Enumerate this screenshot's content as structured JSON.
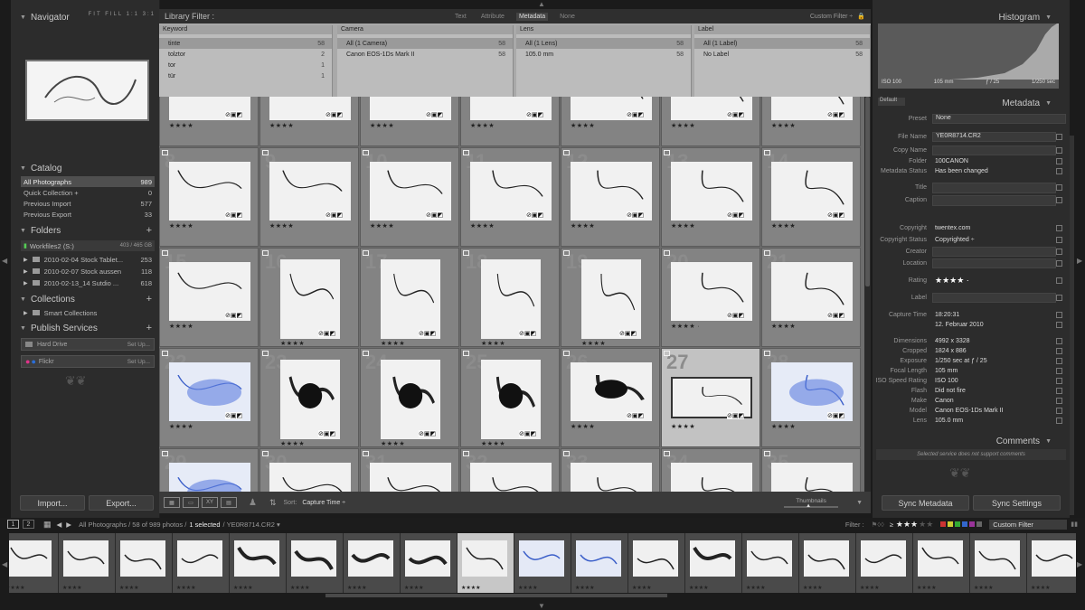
{
  "left_panel": {
    "navigator": {
      "title": "Navigator",
      "zoom_options": "FIT  FILL  1:1  3:1"
    },
    "catalog": {
      "title": "Catalog",
      "items": [
        {
          "label": "All Photographs",
          "count": "989"
        },
        {
          "label": "Quick Collection +",
          "count": "0"
        },
        {
          "label": "Previous Import",
          "count": "577"
        },
        {
          "label": "Previous Export",
          "count": "33"
        }
      ]
    },
    "folders": {
      "title": "Folders",
      "volume": "Workfiles2 (S:)",
      "volume_size": "403 / 465 GB",
      "items": [
        {
          "label": "2010-02-04 Stock Tablet...",
          "count": "253"
        },
        {
          "label": "2010-02-07 Stock aussen",
          "count": "118"
        },
        {
          "label": "2010-02-13_14 Sutdio ...",
          "count": "618"
        }
      ]
    },
    "collections": {
      "title": "Collections",
      "items": [
        "Smart Collections"
      ]
    },
    "publish": {
      "title": "Publish Services",
      "items": [
        {
          "label": "Hard Drive",
          "action": "Set Up..."
        },
        {
          "label": "Flickr",
          "action": "Set Up..."
        }
      ]
    },
    "import_label": "Import...",
    "export_label": "Export..."
  },
  "filter": {
    "title": "Library Filter :",
    "tabs": [
      "Text",
      "Attribute",
      "Metadata",
      "None"
    ],
    "active_tab": "Metadata",
    "preset": "Custom Filter ÷",
    "columns": [
      {
        "header": "Keyword",
        "rows": [
          {
            "l": "tinte",
            "c": "58"
          },
          {
            "l": "tolztor",
            "c": "2"
          },
          {
            "l": "tor",
            "c": "1"
          },
          {
            "l": "tür",
            "c": "1"
          }
        ]
      },
      {
        "header": "Camera",
        "rows": [
          {
            "l": "All (1 Camera)",
            "c": "58"
          },
          {
            "l": "Canon EOS-1Ds Mark II",
            "c": "58"
          }
        ]
      },
      {
        "header": "Lens",
        "rows": [
          {
            "l": "All (1 Lens)",
            "c": "58"
          },
          {
            "l": "105.0 mm",
            "c": "58"
          }
        ]
      },
      {
        "header": "Label",
        "rows": [
          {
            "l": "All (1 Label)",
            "c": "58"
          },
          {
            "l": "No Label",
            "c": "58"
          }
        ]
      }
    ]
  },
  "grid": {
    "rows": [
      {
        "nums": [
          "",
          "",
          "",
          "",
          "",
          "",
          ""
        ],
        "stars": [
          "★★★★",
          "★★★★",
          "★★★★",
          "★★★★",
          "★★★★",
          "★★★★",
          "★★★★"
        ]
      },
      {
        "nums": [
          "8",
          "9",
          "10",
          "11",
          "12",
          "13",
          "14"
        ],
        "stars": [
          "★★★★",
          "★★★★",
          "★★★★",
          "★★★★",
          "★★★★",
          "★★★★",
          "★★★★"
        ]
      },
      {
        "nums": [
          "15",
          "16",
          "17",
          "18",
          "19",
          "20",
          "21"
        ],
        "stars": [
          "★★★★",
          "★★★★",
          "★★★★",
          "★★★★",
          "★★★★",
          "★★★★ ·",
          "★★★★"
        ]
      },
      {
        "nums": [
          "22",
          "23",
          "24",
          "25",
          "26",
          "27",
          "28"
        ],
        "stars": [
          "★★★★",
          "★★★★",
          "★★★★",
          "★★★★",
          "★★★★",
          "★★★★",
          "★★★★"
        ]
      },
      {
        "nums": [
          "29",
          "30",
          "31",
          "32",
          "33",
          "34",
          "35"
        ],
        "stars": [
          "",
          "",
          "",
          "",
          "",
          "",
          ""
        ]
      }
    ]
  },
  "toolbar": {
    "sort_label": "Sort:",
    "sort_value": "Capture Time ÷",
    "thumbnails_label": "Thumbnails"
  },
  "right_panel": {
    "histogram": {
      "title": "Histogram",
      "iso": "ISO 100",
      "focal": "105 mm",
      "aperture": "ƒ / 25",
      "shutter": "1/250 sec"
    },
    "metadata": {
      "preset_select": "Default",
      "title": "Metadata",
      "preset_label": "Preset",
      "preset_value": "None",
      "fields": [
        {
          "l": "File Name",
          "v": "YE0R8714.CR2"
        },
        {
          "l": "Copy Name",
          "v": ""
        },
        {
          "l": "Folder",
          "v": "100CANON"
        },
        {
          "l": "Metadata Status",
          "v": "Has been changed"
        },
        {
          "l": "Title",
          "v": ""
        },
        {
          "l": "Caption",
          "v": ""
        },
        {
          "l": "Copyright",
          "v": "twentex.com"
        },
        {
          "l": "Copyright Status",
          "v": "Copyrighted ÷"
        },
        {
          "l": "Creator",
          "v": ""
        },
        {
          "l": "Location",
          "v": ""
        },
        {
          "l": "Rating",
          "v": "★★★★ ·"
        },
        {
          "l": "Label",
          "v": ""
        },
        {
          "l": "Capture Time",
          "v": "18:20:31"
        },
        {
          "l": "",
          "v": "12. Februar 2010"
        },
        {
          "l": "Dimensions",
          "v": "4992 x 3328"
        },
        {
          "l": "Cropped",
          "v": "1824 x 886"
        },
        {
          "l": "Exposure",
          "v": "1/250 sec at ƒ / 25"
        },
        {
          "l": "Focal Length",
          "v": "105 mm"
        },
        {
          "l": "ISO Speed Rating",
          "v": "ISO 100"
        },
        {
          "l": "Flash",
          "v": "Did not fire"
        },
        {
          "l": "Make",
          "v": "Canon"
        },
        {
          "l": "Model",
          "v": "Canon EOS-1Ds Mark II"
        },
        {
          "l": "Lens",
          "v": "105.0 mm"
        }
      ]
    },
    "comments": {
      "title": "Comments",
      "note": "Selected service does not support comments"
    },
    "sync_metadata": "Sync Metadata",
    "sync_settings": "Sync Settings"
  },
  "filmstrip": {
    "page1": "1",
    "page2": "2",
    "source": "All Photographs / 58 of 989 photos /",
    "selected": "1 selected",
    "file": "/ YE0R8714.CR2 ▾",
    "filter_label": "Filter :",
    "filter_op": "≥",
    "filter_stars": "★★★",
    "custom_filter": "Custom Filter"
  }
}
